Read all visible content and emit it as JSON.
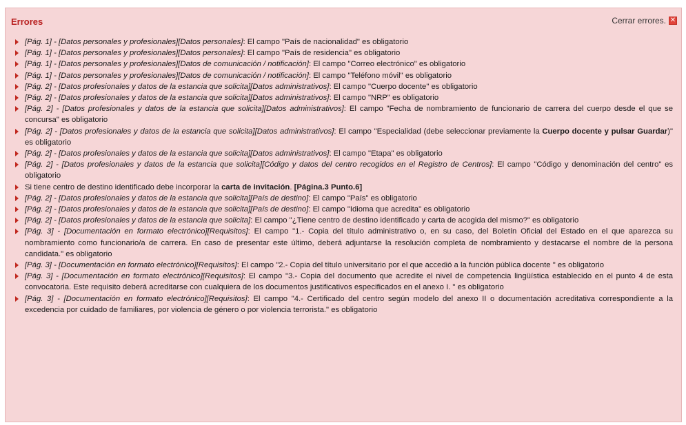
{
  "panel": {
    "title": "Errores",
    "close_label": "Cerrar errores.",
    "close_icon": "✕"
  },
  "errors": [
    {
      "ref": "[Pág. 1] - [Datos personales y profesionales][Datos personales]",
      "msg": ": El campo \"País de nacionalidad\" es obligatorio"
    },
    {
      "ref": "[Pág. 1] - [Datos personales y profesionales][Datos personales]",
      "msg": ": El campo \"País de residencia\" es obligatorio"
    },
    {
      "ref": "[Pág. 1] - [Datos personales y profesionales][Datos de comunicación / notificación]",
      "msg": ": El campo \"Correo electrónico\" es obligatorio"
    },
    {
      "ref": "[Pág. 1] - [Datos personales y profesionales][Datos de comunicación / notificación]",
      "msg": ": El campo \"Teléfono móvil\" es obligatorio"
    },
    {
      "ref": "[Pág. 2] - [Datos profesionales y datos de la estancia que solicita][Datos administrativos]",
      "msg": ": El campo \"Cuerpo docente\" es obligatorio"
    },
    {
      "ref": "[Pág. 2] - [Datos profesionales y datos de la estancia que solicita][Datos administrativos]",
      "msg": ": El campo \"NRP\" es obligatorio"
    },
    {
      "ref": "[Pág. 2] - [Datos profesionales y datos de la estancia que solicita][Datos administrativos]",
      "msg": ": El campo \"Fecha de nombramiento de funcionario de carrera del cuerpo desde el que se concursa\" es obligatorio"
    },
    {
      "ref": "[Pág. 2] - [Datos profesionales y datos de la estancia que solicita][Datos administrativos]",
      "msg": ": El campo \"Especialidad (debe seleccionar previamente la ",
      "bold": "Cuerpo docente y pulsar Guardar",
      "msg2": ")\" es obligatorio"
    },
    {
      "ref": "[Pág. 2] - [Datos profesionales y datos de la estancia que solicita][Datos administrativos]",
      "msg": ": El campo \"Etapa\" es obligatorio"
    },
    {
      "ref": "[Pág. 2] - [Datos profesionales y datos de la estancia que solicita][Código y datos del centro recogidos en el Registro de Centros]",
      "msg": ": El campo \"Código y denominación del centro\" es obligatorio"
    },
    {
      "ref": "",
      "msg": "Si tiene centro de destino identificado debe incorporar la ",
      "bold": "carta de invitación",
      "msg2": ". ",
      "bold2": "[Página.3 Punto.6]"
    },
    {
      "ref": "[Pág. 2] - [Datos profesionales y datos de la estancia que solicita][País de destino]",
      "msg": ": El campo \"País\" es obligatorio"
    },
    {
      "ref": "[Pág. 2] - [Datos profesionales y datos de la estancia que solicita][País de destino]",
      "msg": ": El campo \"Idioma que acredita\" es obligatorio"
    },
    {
      "ref": "[Pág. 2] - [Datos profesionales y datos de la estancia que solicita]",
      "msg": ": El campo \"¿Tiene centro de destino identificado y carta de acogida del mismo?\" es obligatorio"
    },
    {
      "ref": "[Pág. 3] - [Documentación en formato electrónico][Requisitos]",
      "msg": ": El campo \"1.- Copia del título administrativo o, en su caso, del Boletín Oficial del Estado en el que aparezca su nombramiento como funcionario/a de carrera. En caso de presentar este último, deberá adjuntarse la resolución completa de nombramiento y destacarse el nombre de la persona candidata.\" es obligatorio"
    },
    {
      "ref": "[Pág. 3] - [Documentación en formato electrónico][Requisitos]",
      "msg": ": El campo \"2.- Copia del título universitario por el que accedió a la función pública docente \" es obligatorio"
    },
    {
      "ref": "[Pág. 3] - [Documentación en formato electrónico][Requisitos]",
      "msg": ": El campo \"3.- Copia del documento que acredite el nivel de competencia lingüística establecido en el punto 4 de esta convocatoria. Este requisito deberá acreditarse con cualquiera de los documentos justificativos especificados en el anexo I. \" es obligatorio"
    },
    {
      "ref": "[Pág. 3] - [Documentación en formato electrónico][Requisitos]",
      "msg": ": El campo \"4.- Certificado del centro según modelo del anexo II o documentación acreditativa correspondiente a la excedencia por cuidado de familiares, por violencia de género o por violencia terrorista.\" es obligatorio"
    }
  ]
}
